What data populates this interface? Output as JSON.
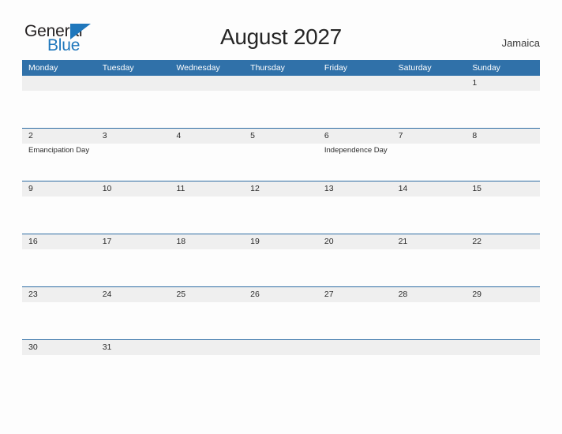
{
  "logo": {
    "word_one": "General",
    "word_two": "Blue",
    "triangle_icon": "triangle-icon",
    "color_dark": "#231f20",
    "color_blue": "#1f77bc"
  },
  "header": {
    "title": "August 2027",
    "country": "Jamaica"
  },
  "colors": {
    "header_blue": "#3071a9",
    "row_divider_blue": "#2e6da4",
    "daynum_band_gray": "#efefef",
    "page_background": "#fdfdfd"
  },
  "calendar": {
    "weekdays": [
      "Monday",
      "Tuesday",
      "Wednesday",
      "Thursday",
      "Friday",
      "Saturday",
      "Sunday"
    ],
    "weeks": [
      {
        "days": [
          {
            "number": "",
            "events": []
          },
          {
            "number": "",
            "events": []
          },
          {
            "number": "",
            "events": []
          },
          {
            "number": "",
            "events": []
          },
          {
            "number": "",
            "events": []
          },
          {
            "number": "",
            "events": []
          },
          {
            "number": "1",
            "events": []
          }
        ]
      },
      {
        "days": [
          {
            "number": "2",
            "events": [
              "Emancipation Day"
            ]
          },
          {
            "number": "3",
            "events": []
          },
          {
            "number": "4",
            "events": []
          },
          {
            "number": "5",
            "events": []
          },
          {
            "number": "6",
            "events": [
              "Independence Day"
            ]
          },
          {
            "number": "7",
            "events": []
          },
          {
            "number": "8",
            "events": []
          }
        ]
      },
      {
        "days": [
          {
            "number": "9",
            "events": []
          },
          {
            "number": "10",
            "events": []
          },
          {
            "number": "11",
            "events": []
          },
          {
            "number": "12",
            "events": []
          },
          {
            "number": "13",
            "events": []
          },
          {
            "number": "14",
            "events": []
          },
          {
            "number": "15",
            "events": []
          }
        ]
      },
      {
        "days": [
          {
            "number": "16",
            "events": []
          },
          {
            "number": "17",
            "events": []
          },
          {
            "number": "18",
            "events": []
          },
          {
            "number": "19",
            "events": []
          },
          {
            "number": "20",
            "events": []
          },
          {
            "number": "21",
            "events": []
          },
          {
            "number": "22",
            "events": []
          }
        ]
      },
      {
        "days": [
          {
            "number": "23",
            "events": []
          },
          {
            "number": "24",
            "events": []
          },
          {
            "number": "25",
            "events": []
          },
          {
            "number": "26",
            "events": []
          },
          {
            "number": "27",
            "events": []
          },
          {
            "number": "28",
            "events": []
          },
          {
            "number": "29",
            "events": []
          }
        ]
      },
      {
        "days": [
          {
            "number": "30",
            "events": []
          },
          {
            "number": "31",
            "events": []
          },
          {
            "number": "",
            "events": []
          },
          {
            "number": "",
            "events": []
          },
          {
            "number": "",
            "events": []
          },
          {
            "number": "",
            "events": []
          },
          {
            "number": "",
            "events": []
          }
        ]
      }
    ]
  }
}
